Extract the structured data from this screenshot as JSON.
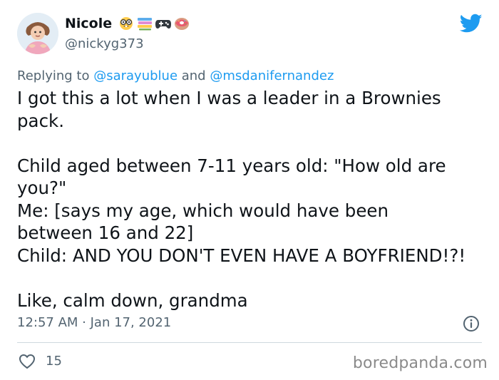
{
  "author": {
    "display_name": "Nicole",
    "handle": "@nickyg373",
    "name_emojis": [
      "nerd-face-emoji",
      "books-emoji",
      "game-controller-emoji",
      "doughnut-emoji"
    ]
  },
  "reply": {
    "prefix": "Replying to ",
    "mention_1": "@sarayublue",
    "joiner": " and ",
    "mention_2": "@msdanifernandez"
  },
  "tweet": {
    "text": "I got this a lot when I was a leader in a Brownies\npack.\n\nChild aged between 7-11 years old: \"How old are\nyou?\"\nMe: [says my age, which would have been\nbetween 16 and 22]\nChild: AND YOU DON'T EVEN HAVE A BOYFRIEND!?!\n\nLike, calm down, grandma",
    "timestamp": "12:57 AM · Jan 17, 2021",
    "likes": "15"
  },
  "watermark": "boredpanda.com",
  "colors": {
    "twitter_blue": "#1d9bf0",
    "text": "#0f1419",
    "secondary": "#536471",
    "divider": "#cfd9de"
  },
  "icons": {
    "brand": "twitter-bird-icon",
    "info": "info-icon",
    "like": "heart-icon"
  }
}
